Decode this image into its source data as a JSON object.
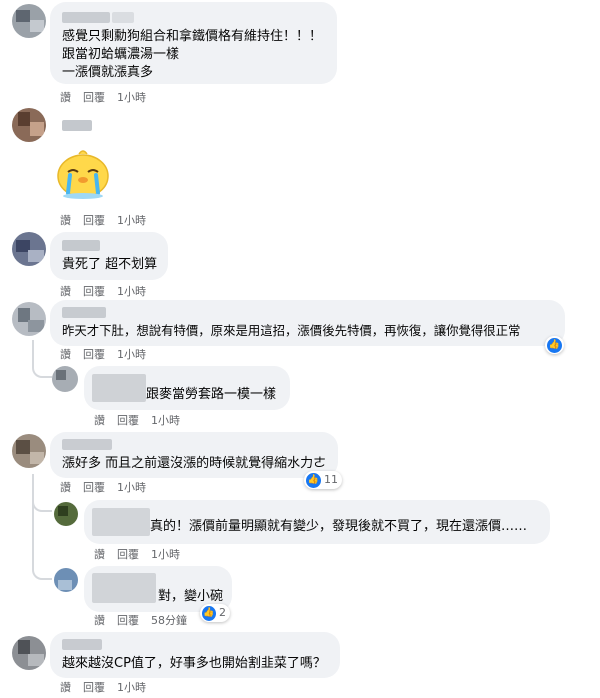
{
  "comments": [
    {
      "lines": [
        "感覺只剩勳狗組合和拿鐵價格有維持住！！！",
        "跟當初蛤蠣濃湯一樣",
        "一漲價就漲真多"
      ],
      "actions": {
        "like": "讚",
        "reply": "回覆",
        "time": "1小時"
      }
    },
    {
      "sticker": "crying-chick-sticker",
      "actions": {
        "like": "讚",
        "reply": "回覆",
        "time": "1小時"
      }
    },
    {
      "lines": [
        "貴死了 超不划算"
      ],
      "actions": {
        "like": "讚",
        "reply": "回覆",
        "time": "1小時"
      }
    },
    {
      "lines": [
        "昨天才下肚，想說有特價，原來是用這招，漲價後先特價，再恢復，讓你覺得很正常"
      ],
      "actions": {
        "like": "讚",
        "reply": "回覆",
        "time": "1小時"
      },
      "replies": [
        {
          "text": "跟麥當勞套路一模一樣",
          "actions": {
            "like": "讚",
            "reply": "回覆",
            "time": "1小時"
          }
        }
      ]
    },
    {
      "lines": [
        "漲好多 而且之前還沒漲的時候就覺得縮水力ㄜ"
      ],
      "reaction_count": "11",
      "actions": {
        "like": "讚",
        "reply": "回覆",
        "time": "1小時"
      },
      "replies": [
        {
          "text": "真的！漲價前量明顯就有變少，發現後就不買了，現在還漲價……",
          "actions": {
            "like": "讚",
            "reply": "回覆",
            "time": "1小時"
          }
        },
        {
          "text": "對，變小碗",
          "reaction_count": "2",
          "actions": {
            "like": "讚",
            "reply": "回覆",
            "time": "58分鐘"
          }
        }
      ]
    },
    {
      "lines": [
        "越來越沒CP值了，好事多也開始割韭菜了嗎？"
      ],
      "actions": {
        "like": "讚",
        "reply": "回覆",
        "time": "1小時"
      }
    }
  ],
  "colors": {
    "bubble": "#f0f2f5",
    "like_blue": "#1877f2",
    "meta_gray": "#65676b"
  }
}
